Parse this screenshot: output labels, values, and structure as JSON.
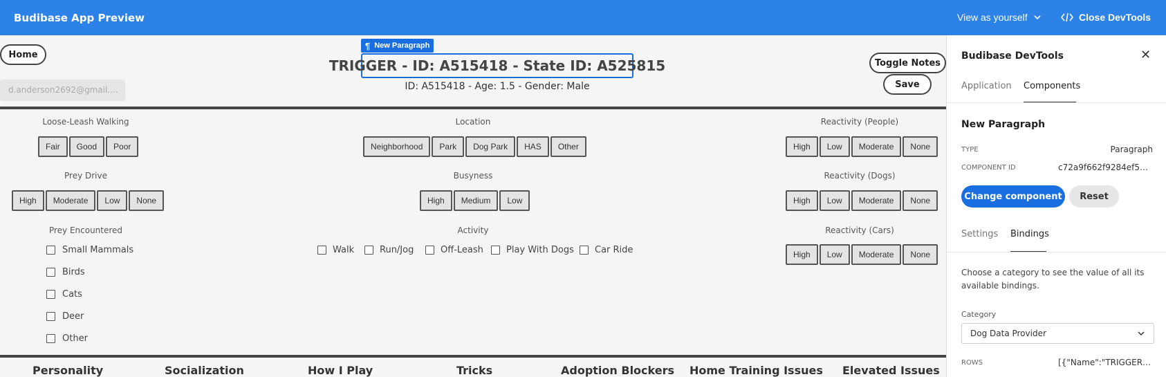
{
  "topbar": {
    "app_title": "Budibase App Preview",
    "view_as": "View as yourself",
    "close_devtools": "Close DevTools"
  },
  "preview": {
    "home_button": "Home",
    "user_email": "d.anderson2692@gmail....",
    "new_paragraph_tag": "New Paragraph",
    "title": "TRIGGER - ID: A515418 - State ID: A525815",
    "subtitle": "ID: A515418 - Age: 1.5 - Gender: Male",
    "toggle_notes_button": "Toggle Notes",
    "save_button": "Save",
    "sections": {
      "loose_leash": {
        "label": "Loose-Leash Walking",
        "options": [
          "Fair",
          "Good",
          "Poor"
        ]
      },
      "location": {
        "label": "Location",
        "options": [
          "Neighborhood",
          "Park",
          "Dog Park",
          "HAS",
          "Other"
        ]
      },
      "reactivity_people": {
        "label": "Reactivity (People)",
        "options": [
          "High",
          "Low",
          "Moderate",
          "None"
        ]
      },
      "prey_drive": {
        "label": "Prey Drive",
        "options": [
          "High",
          "Moderate",
          "Low",
          "None"
        ]
      },
      "busyness": {
        "label": "Busyness",
        "options": [
          "High",
          "Medium",
          "Low"
        ]
      },
      "reactivity_dogs": {
        "label": "Reactivity (Dogs)",
        "options": [
          "High",
          "Low",
          "Moderate",
          "None"
        ]
      },
      "prey_encountered": {
        "label": "Prey Encountered",
        "options": [
          "Small Mammals",
          "Birds",
          "Cats",
          "Deer",
          "Other"
        ]
      },
      "activity": {
        "label": "Activity",
        "options": [
          "Walk",
          "Run/Jog",
          "Off-Leash",
          "Play With Dogs",
          "Car Ride"
        ]
      },
      "reactivity_cars": {
        "label": "Reactivity (Cars)",
        "options": [
          "High",
          "Low",
          "Moderate",
          "None"
        ]
      }
    },
    "bottom_tabs": [
      "Personality",
      "Socialization",
      "How I Play",
      "Tricks",
      "Adoption Blockers",
      "Home Training Issues",
      "Elevated Issues"
    ]
  },
  "devtools": {
    "title": "Budibase DevTools",
    "tabs": [
      "Application",
      "Components"
    ],
    "active_tab": "Components",
    "component_name": "New Paragraph",
    "type_label": "TYPE",
    "type_value": "Paragraph",
    "component_id_label": "COMPONENT ID",
    "component_id_value": "c72a9f662f9284ef592...",
    "change_component_button": "Change component",
    "reset_button": "Reset",
    "subtabs": [
      "Settings",
      "Bindings"
    ],
    "active_subtab": "Bindings",
    "help_text": "Choose a category to see the value of all its available bindings.",
    "category_label": "Category",
    "category_value": "Dog Data Provider",
    "rows_label": "ROWS",
    "rows_value": "[{\"Name\":\"TRIGGER\",..."
  },
  "colors": {
    "topbar": "#2c82e6",
    "accent": "#1a6fe0"
  }
}
